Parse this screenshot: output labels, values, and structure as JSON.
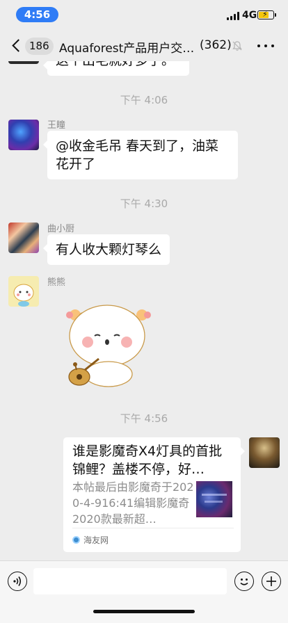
{
  "status_bar": {
    "time": "4:56",
    "network": "4G",
    "battery_level": 0.75,
    "battery_color": "#f5c60a",
    "time_pill_color": "#2f7cf6"
  },
  "nav": {
    "unread_count": "186",
    "title": "Aquaforest产品用户交…",
    "member_count": "(362)",
    "back_icon": "chevron-left-icon",
    "mute_icon": "bell-muted-icon",
    "more_icon": "more-dots-icon"
  },
  "chat": {
    "partial_top_text": "这个出毛就好多了。",
    "timestamps": [
      "下午 4:06",
      "下午 4:30",
      "下午 4:56"
    ],
    "messages": [
      {
        "sender": "王瞳",
        "text": "@收金毛吊 春天到了，油菜花开了"
      },
      {
        "sender": "曲小厨",
        "text": "有人收大颗灯琴么"
      },
      {
        "sender": "熊熊",
        "sticker": "bear-playing-instrument-sticker"
      }
    ],
    "link_card": {
      "title": "谁是影魔奇X4灯具的首批锦鲤？盖楼不停，好…",
      "description": "本帖最后由影魔奇于2020-4-916:41编辑影魔奇 2020款最新超…",
      "source": "海友网"
    }
  },
  "input_bar": {
    "voice_icon": "voice-icon",
    "emoji_icon": "emoji-icon",
    "add_icon": "plus-icon",
    "input_value": ""
  }
}
